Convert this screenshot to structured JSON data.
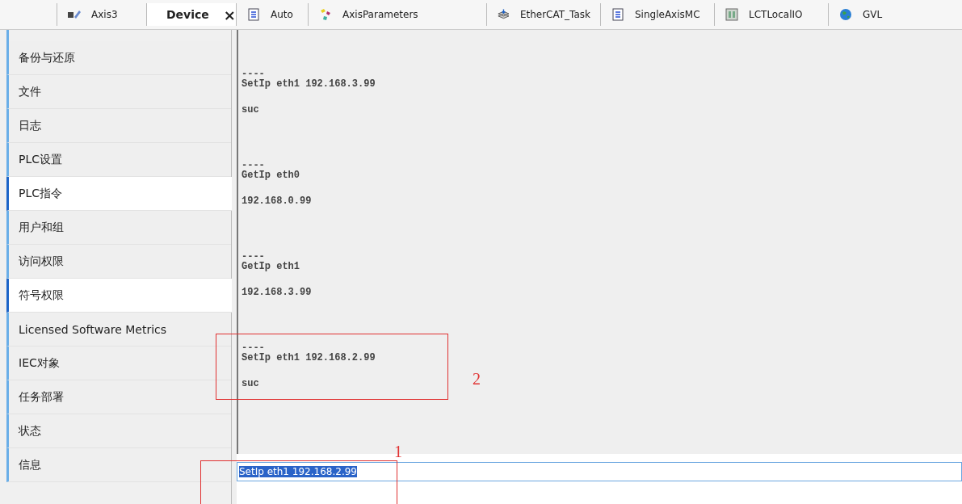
{
  "tabs": [
    {
      "label": "Axis3",
      "kind": "axis",
      "selected": false
    },
    {
      "label": "Device",
      "kind": "device",
      "selected": true,
      "close": "×"
    },
    {
      "label": "Auto",
      "kind": "document",
      "selected": false
    },
    {
      "label": "AxisParameters",
      "kind": "params",
      "selected": false
    },
    {
      "label": "EtherCAT_Task",
      "kind": "task",
      "selected": false
    },
    {
      "label": "SingleAxisMC",
      "kind": "document",
      "selected": false
    },
    {
      "label": "LCTLocalIO",
      "kind": "device",
      "selected": false
    },
    {
      "label": "GVL",
      "kind": "globe",
      "selected": false
    }
  ],
  "sidebar": {
    "items": [
      {
        "label": "备份与还原",
        "selected": false
      },
      {
        "label": "文件",
        "selected": false
      },
      {
        "label": "日志",
        "selected": false
      },
      {
        "label": "PLC设置",
        "selected": false
      },
      {
        "label": "PLC指令",
        "selected": true
      },
      {
        "label": "用户和组",
        "selected": false
      },
      {
        "label": "访问权限",
        "selected": false
      },
      {
        "label": "符号权限",
        "selected": true
      },
      {
        "label": "Licensed Software Metrics",
        "selected": false
      },
      {
        "label": "IEC对象",
        "selected": false
      },
      {
        "label": "任务部署",
        "selected": false
      },
      {
        "label": "状态",
        "selected": false
      },
      {
        "label": "信息",
        "selected": false
      }
    ]
  },
  "console": {
    "blocks": [
      {
        "separator": "----",
        "command": "SetIp eth1 192.168.3.99",
        "result": "suc"
      },
      {
        "separator": "----",
        "command": "GetIp eth0",
        "result": "192.168.0.99"
      },
      {
        "separator": "----",
        "command": "GetIp eth1",
        "result": "192.168.3.99"
      },
      {
        "separator": "----",
        "command": "SetIp eth1 192.168.2.99",
        "result": "suc"
      }
    ]
  },
  "command_input": {
    "value": "SetIp eth1 192.168.2.99",
    "selected": true
  },
  "annotations": [
    {
      "label": "2"
    },
    {
      "label": "1"
    }
  ]
}
